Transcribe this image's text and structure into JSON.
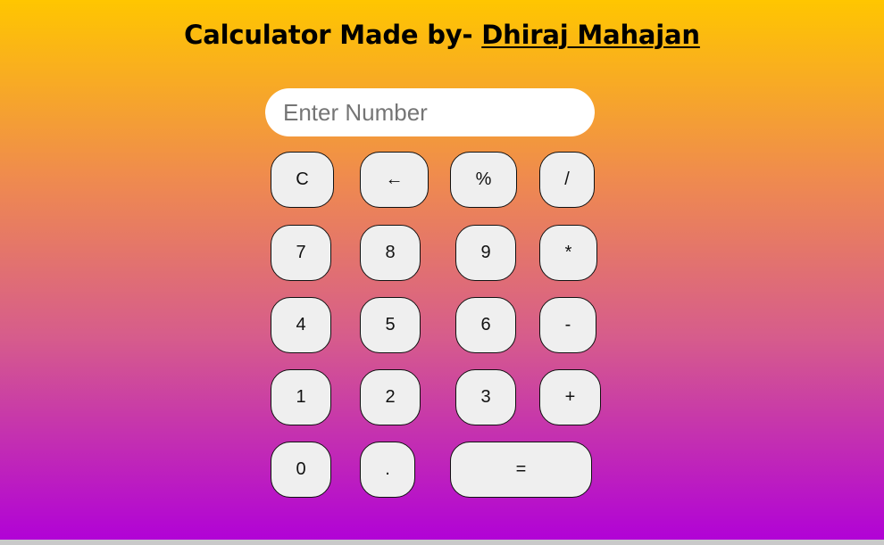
{
  "header": {
    "title_prefix": "Calculator Made by- ",
    "author": "Dhiraj Mahajan"
  },
  "display": {
    "placeholder": "Enter Number",
    "value": ""
  },
  "keys": {
    "clear": "C",
    "backspace": "←",
    "percent": "%",
    "divide": "/",
    "seven": "7",
    "eight": "8",
    "nine": "9",
    "multiply": "*",
    "four": "4",
    "five": "5",
    "six": "6",
    "subtract": "-",
    "one": "1",
    "two": "2",
    "three": "3",
    "add": "+",
    "zero": "0",
    "decimal": ".",
    "equals": "="
  },
  "colors": {
    "gradient_top": "#ffc600",
    "gradient_bottom": "#b000d8",
    "key_background": "#efefef"
  }
}
